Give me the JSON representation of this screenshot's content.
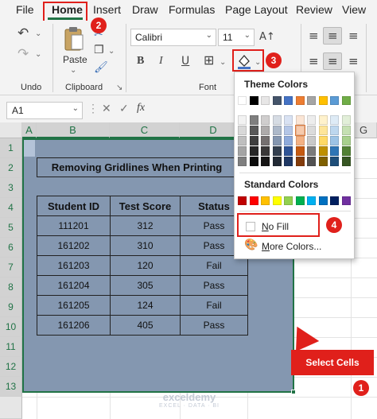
{
  "menu": {
    "items": [
      "File",
      "Home",
      "Insert",
      "Draw",
      "Formulas",
      "Page Layout",
      "Review",
      "View"
    ]
  },
  "ribbon": {
    "undo_label": "Undo",
    "clipboard_label": "Clipboard",
    "paste_label": "Paste",
    "font_group_label": "Font",
    "font_name": "Calibri",
    "font_size": "11",
    "bold": "B",
    "italic": "I"
  },
  "formula_bar": {
    "name_box": "A1",
    "fx": "fx",
    "cancel": "✕",
    "enter": "✓"
  },
  "grid": {
    "columns": [
      "A",
      "B",
      "C",
      "D",
      "G"
    ],
    "rows": [
      "1",
      "2",
      "3",
      "4",
      "5",
      "6",
      "7",
      "8",
      "9",
      "10",
      "11",
      "12",
      "13"
    ],
    "title": "Removing Gridlines When Printing",
    "headers": [
      "Student ID",
      "Test Score",
      "Status"
    ],
    "data": [
      [
        "111201",
        "312",
        "Pass"
      ],
      [
        "161202",
        "310",
        "Pass"
      ],
      [
        "161203",
        "120",
        "Fail"
      ],
      [
        "161204",
        "305",
        "Pass"
      ],
      [
        "161205",
        "124",
        "Fail"
      ],
      [
        "161206",
        "405",
        "Pass"
      ]
    ]
  },
  "fill_dropdown": {
    "theme_colors_label": "Theme Colors",
    "standard_colors_label": "Standard Colors",
    "no_fill_label": "No Fill",
    "no_fill_access_key": "N",
    "no_fill_rest": "o Fill",
    "more_colors_label": "More Colors...",
    "more_colors_access_key": "M",
    "more_colors_rest": "ore Colors...",
    "theme_top_row": [
      "#ffffff",
      "#000000",
      "#e7e6e6",
      "#44546a",
      "#4472c4",
      "#ed7d31",
      "#a5a5a5",
      "#ffc000",
      "#5b9bd5",
      "#70ad47"
    ],
    "theme_shades": [
      [
        "#f2f2f2",
        "#7f7f7f",
        "#d0cece",
        "#d6dce4",
        "#d9e2f3",
        "#fbe5d5",
        "#ededed",
        "#fff2cc",
        "#deebf6",
        "#e2efd9"
      ],
      [
        "#d8d8d8",
        "#595959",
        "#aeabab",
        "#adb9ca",
        "#b4c6e7",
        "#f7caac",
        "#dbdbdb",
        "#fee599",
        "#bdd7ee",
        "#c5e0b3"
      ],
      [
        "#bfbfbf",
        "#3f3f3f",
        "#757070",
        "#8496b0",
        "#8eaadb",
        "#f4b183",
        "#c9c9c9",
        "#ffd965",
        "#9cc3e5",
        "#a8d08d"
      ],
      [
        "#a5a5a5",
        "#262626",
        "#3a3838",
        "#333f4f",
        "#2f5496",
        "#c55a11",
        "#7b7b7b",
        "#bf9000",
        "#2e75b5",
        "#538135"
      ],
      [
        "#7f7f7f",
        "#0c0c0c",
        "#171616",
        "#222a35",
        "#1f3864",
        "#833c0b",
        "#525252",
        "#7f6000",
        "#1e4e79",
        "#375623"
      ]
    ],
    "standard": [
      "#c00000",
      "#ff0000",
      "#ffc000",
      "#ffff00",
      "#92d050",
      "#00b050",
      "#00b0f0",
      "#0070c0",
      "#002060",
      "#7030a0"
    ]
  },
  "annotations": {
    "badges": [
      "1",
      "2",
      "3",
      "4"
    ],
    "callout": "Select Cells"
  },
  "watermark": {
    "brand": "exceldemy",
    "tagline": "EXCEL · DATA · BI"
  },
  "colors": {
    "accent_green": "#217346",
    "selection_fill": "#8497b0",
    "annotation_red": "#e0201b"
  }
}
